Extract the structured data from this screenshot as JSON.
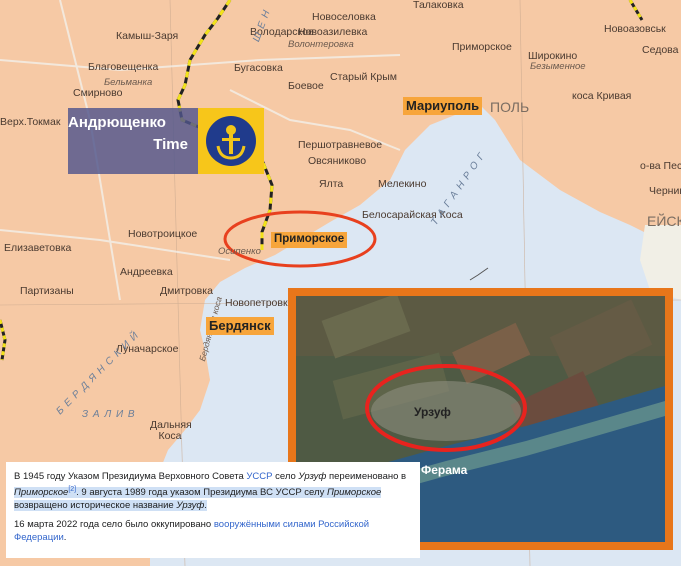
{
  "map_labels": {
    "talakovka": "Талаковка",
    "novoazovsk": "Новоазовськ",
    "sedova": "Седова",
    "kamysh_zarya": "Камыш-Заря",
    "volodarskoe": "Володарское",
    "novoselovka": "Новоселовка",
    "novovasilevka": "Новоазилевка",
    "volonterovka": "Волонтеровка",
    "blagoveshchenka": "Благовещенка",
    "smirnovo": "Смирново",
    "belmanka": "Бельманка",
    "primorskoe_n": "Приморское",
    "shirokino": "Широкино",
    "bezymennoe": "Безыменное",
    "bugasovka": "Бугасовка",
    "staryi_krym": "Старый Крым",
    "boevoe": "Боевое",
    "kosa_krivaya": "коса Кривая",
    "verh_tokmak": "Верх.Токмак",
    "pershotravnevoe": "Першотравневое",
    "ovsyanikovo": "Овсяниково",
    "yalta": "Ялта",
    "melekino": "Мелекино",
    "o_va_peschanye": "о-ва Песчаные",
    "chernigovka": "Чернигова",
    "belosaraiskaya_kosa": "Белосарайская Коса",
    "elizavetovka": "Елизаветовка",
    "novotroitskoe": "Новотроицкое",
    "osipenko": "Осипенко",
    "andrevka": "Андреевка",
    "dmitrovka": "Дмитровка",
    "partizany": "Партизаны",
    "novopetrovka": "Новопетровка",
    "lunacharskoe": "Луначарское",
    "dalnyaya_kosa": "Дальняя Коса",
    "sea_taganrog": "Т А Г А Н Р О Г",
    "berdyansk_zaliv": "Б Е Р Д Я Н С К И Й",
    "zaliv": "З А Л И В",
    "yeisk": "ЕЙСК",
    "pol": "ПОЛЬ",
    "ushene": "Ш Е Н",
    "berdyansk_kosa": "Бердянская коса"
  },
  "city_tags": {
    "mariupol": "Мариуполь",
    "primorskoe": "Приморское",
    "berdyansk": "Бердянск"
  },
  "logo": {
    "line1": "Андрющенко",
    "line2": "Time",
    "icon": "anchor-icon"
  },
  "inset": {
    "label": "Урзуф",
    "label_bottom": "Ферама"
  },
  "wiki": {
    "p1_a": "В 1945 году Указом Президиума Верховного Совета ",
    "p1_link1": "УССР",
    "p1_b": " село ",
    "p1_i1": "Урзуф",
    "p1_c": " переименовано в ",
    "p1_i2": "Приморское",
    "p1_sup": "[2]",
    "p1_d": ". 9 августа 1989 года указом Президиума ВС УССР селу ",
    "p1_i3": "Приморское",
    "p1_e": " возвращено историческое название ",
    "p1_i4": "Урзуф",
    "p1_f": ".",
    "p2_a": "16 марта 2022 года село было оккупировано ",
    "p2_link": "вооружёнными силами Российской Федерации",
    "p2_b": "."
  },
  "colors": {
    "land": "#f6c9a5",
    "sea": "#dce7f3",
    "highlight_ring": "#e8401e",
    "tag": "#f7a53b",
    "inset_frame": "#e8761a"
  }
}
